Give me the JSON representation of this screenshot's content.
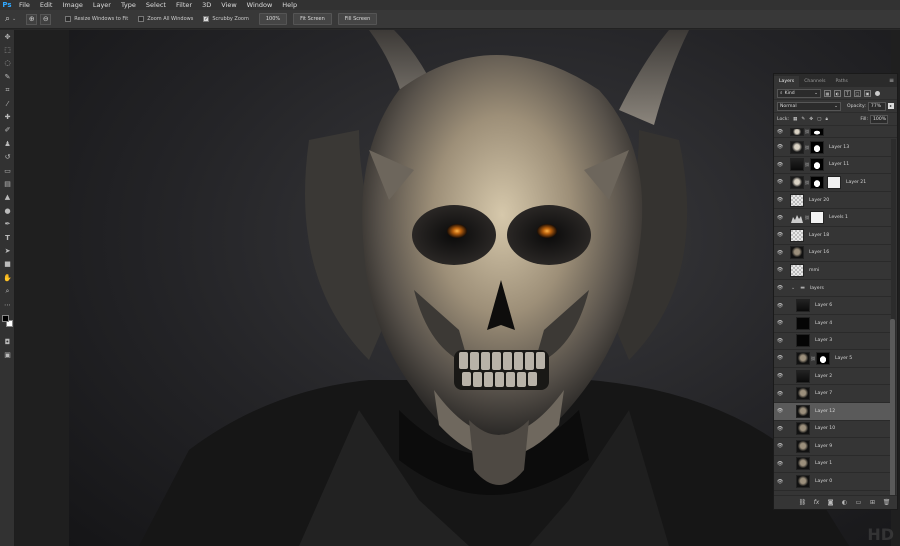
{
  "app": {
    "logo": "Ps"
  },
  "menu": [
    "File",
    "Edit",
    "Image",
    "Layer",
    "Type",
    "Select",
    "Filter",
    "3D",
    "View",
    "Window",
    "Help"
  ],
  "options": {
    "resize_windows": "Resize Windows to Fit",
    "zoom_all": "Zoom All Windows",
    "scrubby": "Scrubby Zoom",
    "zoom_level": "100%",
    "fit_screen": "Fit Screen",
    "fill_screen": "Fill Screen",
    "scrubby_checked": true
  },
  "panel": {
    "tabs": [
      "Layers",
      "Channels",
      "Paths"
    ],
    "filter_label": "Kind",
    "blend_mode": "Normal",
    "opacity_label": "Opacity:",
    "opacity_value": "77%",
    "lock_label": "Lock:",
    "fill_label": "Fill:",
    "fill_value": "100%"
  },
  "layers": [
    {
      "name": "Layer 13",
      "thumb": "face",
      "mask": "sil",
      "indent": false,
      "selected": false
    },
    {
      "name": "Layer 11",
      "thumb": "dark",
      "mask": "sil",
      "indent": false,
      "selected": false
    },
    {
      "name": "Layer 21",
      "thumb": "face",
      "mask": "sil",
      "mask2": "white",
      "indent": false,
      "selected": false
    },
    {
      "name": "Layer 20",
      "thumb": "ck",
      "indent": false,
      "selected": false
    },
    {
      "name": "Levels 1",
      "thumb": "levels",
      "mask": "white",
      "indent": false,
      "selected": false
    },
    {
      "name": "Layer 18",
      "thumb": "ck",
      "indent": false,
      "selected": false
    },
    {
      "name": "Layer 16",
      "thumb": "skullt",
      "indent": false,
      "selected": false
    },
    {
      "name": "mmi",
      "thumb": "ck",
      "indent": false,
      "selected": false
    },
    {
      "name": "layers",
      "group": true,
      "indent": false,
      "selected": false
    },
    {
      "name": "Layer 6",
      "thumb": "dark",
      "indent": true,
      "selected": false
    },
    {
      "name": "Layer 4",
      "thumb": "black",
      "indent": true,
      "selected": false
    },
    {
      "name": "Layer 3",
      "thumb": "black",
      "indent": true,
      "selected": false
    },
    {
      "name": "Layer 5",
      "thumb": "skullt",
      "mask": "sil",
      "indent": true,
      "selected": false
    },
    {
      "name": "Layer 2",
      "thumb": "dark",
      "indent": true,
      "selected": false
    },
    {
      "name": "Layer 7",
      "thumb": "skullt",
      "indent": true,
      "selected": false
    },
    {
      "name": "Layer 12",
      "thumb": "skullt",
      "indent": true,
      "selected": true
    },
    {
      "name": "Layer 10",
      "thumb": "skullt",
      "indent": true,
      "selected": false
    },
    {
      "name": "Layer 9",
      "thumb": "skullt",
      "indent": true,
      "selected": false
    },
    {
      "name": "Layer 1",
      "thumb": "skullt",
      "indent": true,
      "selected": false
    },
    {
      "name": "Layer 0",
      "thumb": "skullt",
      "indent": true,
      "selected": false
    }
  ],
  "colors": {
    "accent": "#31a8ff",
    "panel_bg": "#353535",
    "canvas_bg": "#1f1f1f"
  },
  "watermark": "HD"
}
